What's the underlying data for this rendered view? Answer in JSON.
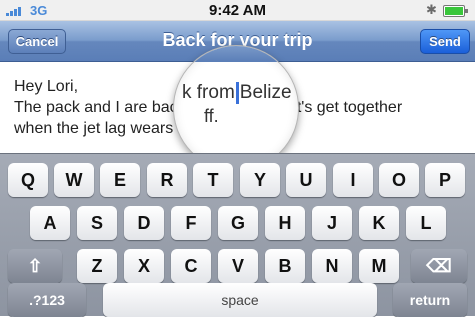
{
  "status_bar": {
    "carrier": "3G",
    "time": "9:42 AM",
    "bluetooth_icon": "bluetooth-icon",
    "battery_icon": "battery-icon"
  },
  "nav": {
    "title": "Back for your trip",
    "cancel_label": "Cancel",
    "send_label": "Send"
  },
  "message": {
    "lines": [
      "Hey Lori,",
      "The pack and I are back from Belize. Let's get together",
      "when the jet lag wears off."
    ]
  },
  "magnifier": {
    "before_caret": "k from",
    "after_caret": "Belize",
    "below": "ff."
  },
  "keyboard": {
    "row1": [
      "Q",
      "W",
      "E",
      "R",
      "T",
      "Y",
      "U",
      "I",
      "O",
      "P"
    ],
    "row2": [
      "A",
      "S",
      "D",
      "F",
      "G",
      "H",
      "J",
      "K",
      "L"
    ],
    "row3": [
      "Z",
      "X",
      "C",
      "V",
      "B",
      "N",
      "M"
    ],
    "shift_icon": "shift-arrow-icon",
    "delete_icon": "delete-icon",
    "numbers_label": ".?123",
    "space_label": "space",
    "return_label": "return"
  }
}
